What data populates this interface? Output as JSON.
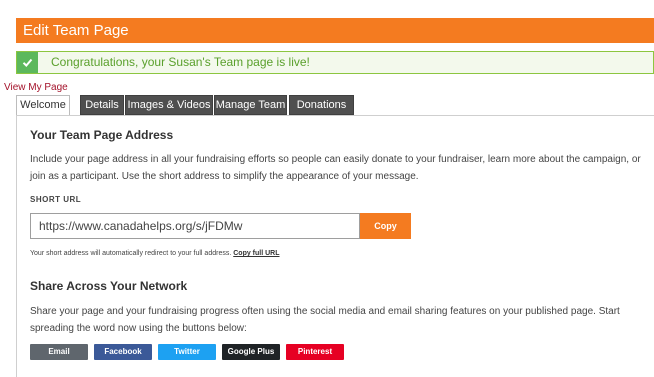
{
  "header": {
    "title": "Edit Team Page"
  },
  "alert": {
    "message": "Congratulations, your Susan's Team page is live!"
  },
  "view_link": "View My Page",
  "tabs": [
    {
      "label": "Welcome",
      "active": true
    },
    {
      "label": "Details",
      "active": false
    },
    {
      "label": "Images & Videos",
      "active": false
    },
    {
      "label": "Manage Team",
      "active": false
    },
    {
      "label": "Donations",
      "active": false
    }
  ],
  "address_section": {
    "title": "Your Team Page Address",
    "description": "Include your page address in all your fundraising efforts so people can easily donate to your fundraiser, learn more about the campaign, or join as a participant. Use the short address to simplify the appearance of your message.",
    "short_url_label": "SHORT URL",
    "short_url": "https://www.canadahelps.org/s/jFDMw",
    "copy_label": "Copy",
    "redirect_note": "Your short address will automatically redirect to your full address.",
    "copy_full_url_label": "Copy full URL"
  },
  "share_section": {
    "title": "Share Across Your Network",
    "description": "Share your page and your fundraising progress often using the social media and email sharing features on your published page. Start spreading the word now using the buttons below:",
    "buttons": [
      {
        "label": "Email",
        "color": "#5f666d"
      },
      {
        "label": "Facebook",
        "color": "#3b5998"
      },
      {
        "label": "Twitter",
        "color": "#1da1f2"
      },
      {
        "label": "Google Plus",
        "color": "#1f2326"
      },
      {
        "label": "Pinterest",
        "color": "#e60023"
      }
    ]
  },
  "colors": {
    "brand_orange": "#f47b20",
    "success_green": "#5cb85c",
    "link_red": "#a4122a"
  }
}
